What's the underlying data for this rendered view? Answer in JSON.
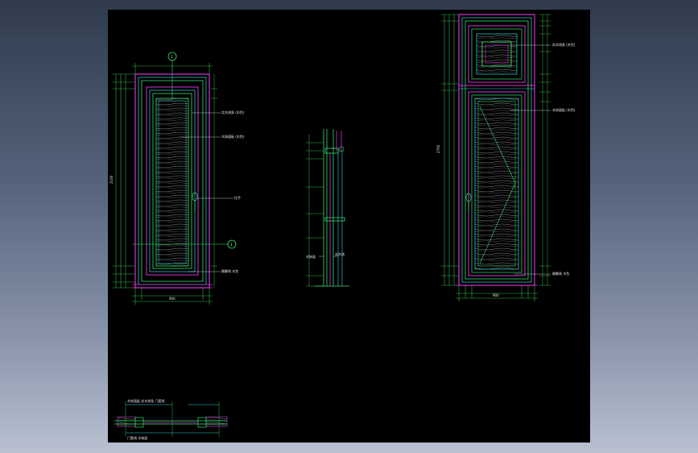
{
  "drawing": {
    "colors": {
      "background_outer": "#55627a",
      "paper": "#000000",
      "frame_magenta": "#d531d8",
      "frame_green": "#34e070",
      "frame_cyan": "#2fd7dc",
      "dimension_green": "#2fb84a",
      "wood_grain": "#9a9a9a",
      "annotation": "#e8e8e8"
    },
    "left_elevation": {
      "callout_top": "1",
      "callout_bottom": "1",
      "labels": {
        "upper_frame": "实木线条 (木色)",
        "upper_panel": "木饰面板 (木色)",
        "handle": "拉手",
        "base": "踢脚线 木色"
      },
      "dim_bottom": "900",
      "dim_height": "2100"
    },
    "section": {
      "labels": {
        "left": "木饰面",
        "right": "实木线"
      }
    },
    "right_elevation": {
      "labels": {
        "top_panel": "实木线条 (木色)",
        "main_panel": "木饰面板 (木色)",
        "base": "踢脚线 木色"
      },
      "dim_bottom": "900",
      "dim_height": "2700"
    },
    "plan": {
      "label_top": "木饰面板 实木线条 门套线",
      "label_bottom": "门套线 木饰面"
    }
  }
}
